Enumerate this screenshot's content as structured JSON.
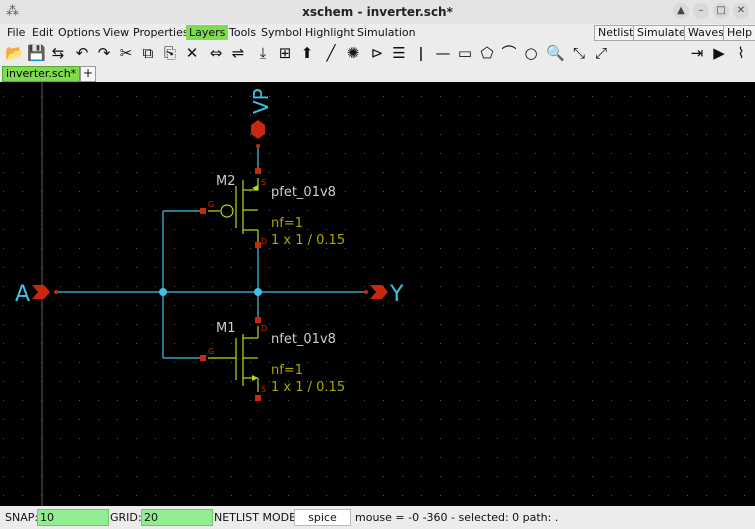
{
  "window": {
    "title": "xschem - inverter.sch*",
    "controls": [
      "▲",
      "–",
      "□",
      "✕"
    ]
  },
  "menu": {
    "items": [
      "File",
      "Edit",
      "Options",
      "View",
      "Properties",
      "Layers",
      "Tools",
      "Symbol",
      "Highlight",
      "Simulation"
    ],
    "active": "Layers",
    "right_buttons": [
      "Netlist",
      "Simulate",
      "Waves",
      "Help"
    ],
    "active_color": "#7fdc4e"
  },
  "toolbar": {
    "icons": [
      "open-folder-icon",
      "save-icon",
      "reload-icon",
      "undo-icon",
      "redo-icon",
      "cut-icon",
      "copy-icon",
      "paste-icon",
      "delete-icon",
      "move-icon",
      "swap-icon",
      "push-down-icon",
      "push-symbol-icon",
      "pop-up-icon",
      "wire-icon",
      "highlight-icon",
      "symbol-icon",
      "list-icon",
      "pin-icon",
      "line-icon",
      "rectangle-icon",
      "polygon-icon",
      "arc-icon",
      "circle-icon",
      "zoom-icon",
      "zoom-in-icon",
      "zoom-out-icon",
      "netlist-icon",
      "run-icon",
      "waves-icon"
    ],
    "glyphs": [
      "📂",
      "💾",
      "⇆",
      "↶",
      "↷",
      "✂",
      "⧉",
      "⎘",
      "✕",
      "⇔",
      "⇌",
      "⤓",
      "⊞",
      "⬆",
      "╱",
      "✺",
      "⊳",
      "☰",
      "ǀ",
      "—",
      "▭",
      "⬠",
      "⌒",
      "○",
      "🔍",
      "⤡",
      "⤢",
      "⇥",
      "▶",
      "⌇"
    ]
  },
  "tabs": {
    "items": [
      "inverter.sch*"
    ],
    "add_label": "+"
  },
  "schematic": {
    "colors": {
      "background": "#000000",
      "wire": "#3fc1e5",
      "pin": "#c8280f",
      "device": "#b4dc14",
      "text": "#cccccc",
      "param": "#a8a800",
      "grid": "#5a5a5a"
    },
    "labels": {
      "input": "A",
      "output": "Y",
      "supply": "VP",
      "m2_name": "M2",
      "m2_model": "pfet_01v8",
      "m2_nf": "nf=1",
      "m2_size": "1 x 1 / 0.15",
      "m1_name": "M1",
      "m1_model": "nfet_01v8",
      "m1_nf": "nf=1",
      "m1_size": "1 x 1 / 0.15",
      "pin_s_top": "S",
      "pin_g_top": "G",
      "pin_d_top": "D",
      "pin_s_bot": "S",
      "pin_g_bot": "G",
      "pin_d_bot": "D"
    }
  },
  "status": {
    "snap_label": "SNAP:",
    "snap_value": "10",
    "grid_label": "GRID:",
    "grid_value": "20",
    "netlist_label": "NETLIST MODE:",
    "netlist_value": "spice",
    "info": "mouse = -0 -360 - selected: 0 path: ."
  }
}
